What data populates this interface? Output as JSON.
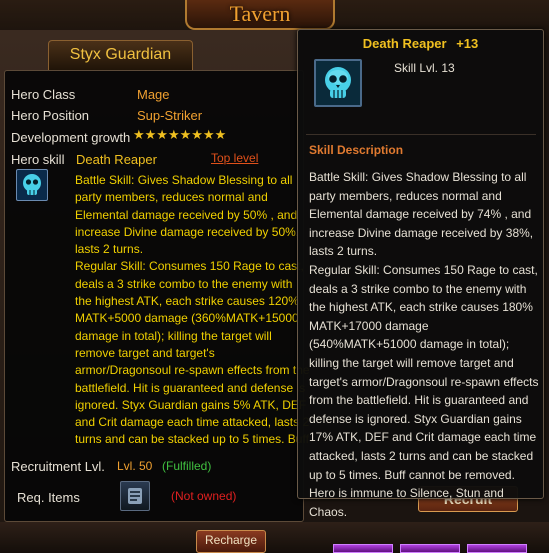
{
  "screen": {
    "title": "Tavern"
  },
  "hero": {
    "name": "Styx Guardian",
    "class_label": "Hero Class",
    "class_value": "Mage",
    "position_label": "Hero Position",
    "position_value": "Sup-Striker",
    "growth_label": "Development growth",
    "growth_stars": "★★★★★★★★",
    "skill_label": "Hero skill",
    "skill_name": "Death Reaper",
    "top_level_link": "Top level",
    "skill_description": "Battle Skill: Gives Shadow Blessing to all party members, reduces normal and Elemental damage received by 50% , and increase Divine damage received by 50%, lasts 2 turns.\nRegular Skill: Consumes 150 Rage to cast, deals a 3 strike combo to the enemy with the highest ATK, each strike causes 120% MATK+5000 damage (360%MATK+15000 damage in total); killing the target will remove target and target's armor/Dragonsoul re-spawn effects from the battlefield. Hit is guaranteed and defense is ignored. Styx Guardian gains 5% ATK, DEF and Crit damage each time attacked, lasts 2 turns and can be stacked up to 5 times. Buff cannot be removed. Hero is immune to Silence, Stun and Chaos.",
    "recruit_label": "Recruitment Lvl.",
    "recruit_level": "Lvl. 50",
    "recruit_status": "(Fulfilled)",
    "req_items_label": "Req. Items",
    "req_items_status": "(Not owned)"
  },
  "tooltip": {
    "skill_name": "Death Reaper",
    "skill_plus": "+13",
    "skill_level": "Skill Lvl. 13",
    "section_title": "Skill Description",
    "description": "Battle Skill: Gives Shadow Blessing to all party members, reduces normal and Elemental damage received by 74% , and increase Divine damage received by 38%, lasts 2 turns.\nRegular Skill: Consumes 150 Rage to cast, deals a 3 strike combo to the enemy with the highest ATK, each strike causes 180% MATK+17000 damage (540%MATK+51000 damage in total); killing the target will remove target and target's armor/Dragonsoul re-spawn effects from the battlefield. Hit is guaranteed and defense is ignored. Styx Guardian gains 17% ATK, DEF and Crit damage each time attacked, lasts 2 turns and can be stacked up to 5 times. Buff cannot be removed. Hero is immune to Silence, Stun and Chaos."
  },
  "buttons": {
    "recharge": "Recharge",
    "recruit": "Recruit"
  },
  "icons": {
    "skill": "skull-icon",
    "req_item": "scroll-item-icon"
  },
  "colors": {
    "title_gold": "#f0c020",
    "value_orange": "#f0a030",
    "desc_yellow": "#f0d000",
    "fulfilled_green": "#40c040",
    "not_owned_red": "#e02020",
    "section_orange": "#e07a30"
  }
}
